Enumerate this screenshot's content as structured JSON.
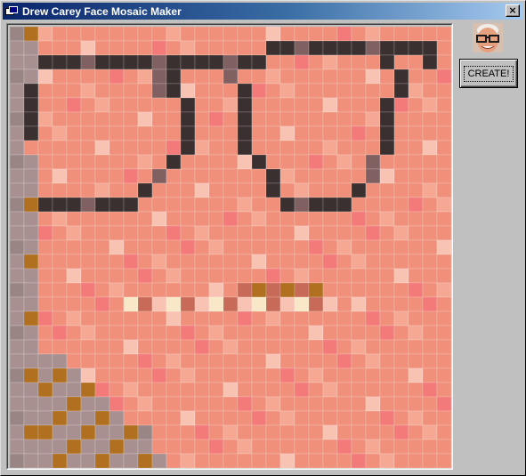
{
  "window": {
    "title": "Drew Carey Face Mosaic Maker",
    "close_glyph": "×"
  },
  "toolbar": {
    "create_label": "CREATE!"
  },
  "thumbnail": {
    "description_icon": "face-photo-icon",
    "skin": "#e6a07e",
    "hair": "#f0ece8",
    "glasses": "#1a1a1a"
  },
  "mosaic": {
    "palette": {
      "s": "#f0907a",
      "p": "#f5a995",
      "l": "#f8c3b3",
      "r": "#f27a78",
      "d": "#3a3030",
      "g": "#9a8585",
      "b": "#b07020",
      "w": "#f8e8c8",
      "m": "#c86a58",
      "n": "#8a2a20",
      "k": "#806060",
      "x": "#a89090"
    }
  }
}
